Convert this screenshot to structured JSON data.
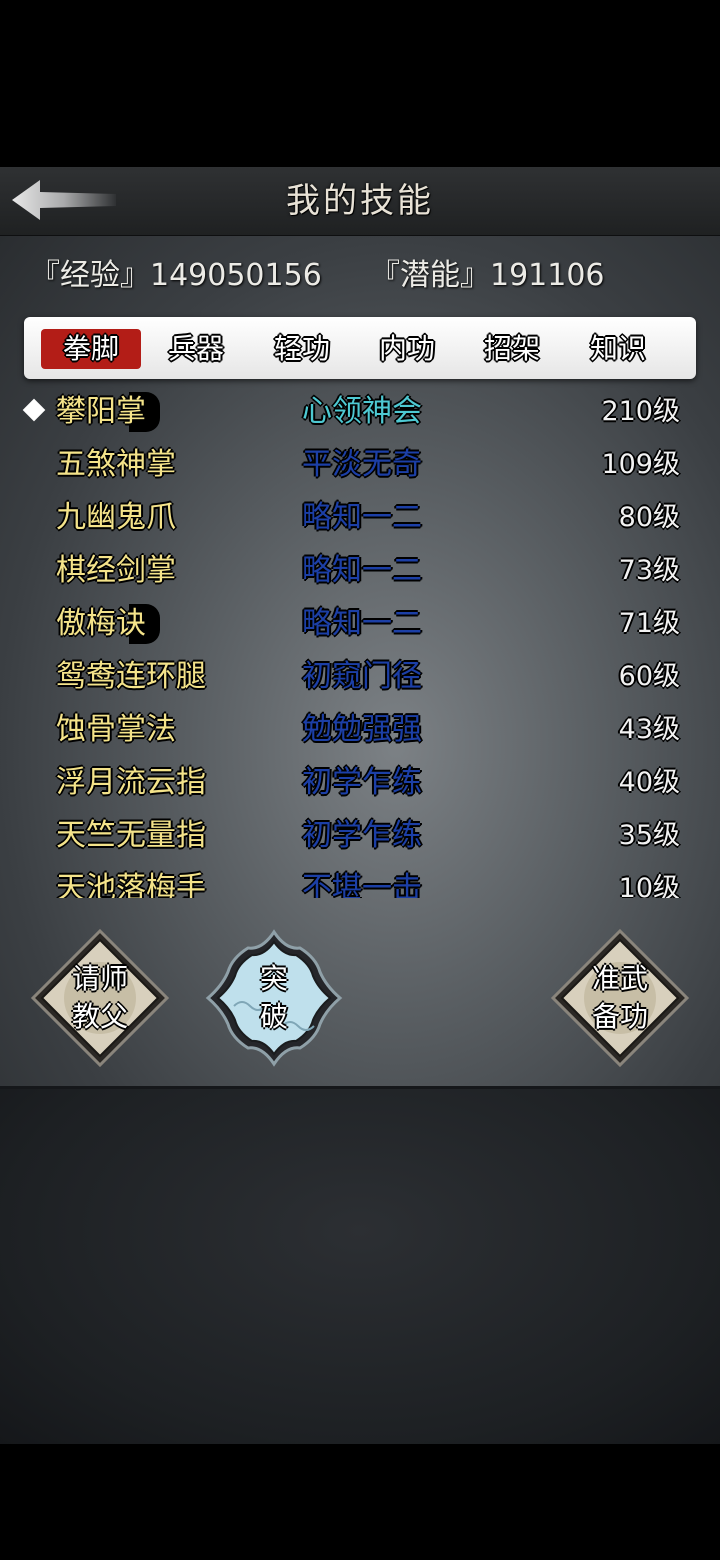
{
  "header": {
    "title": "我的技能",
    "back_icon": "back-arrow-icon"
  },
  "stats": {
    "experience": "『经验』149050156",
    "potential": "『潜能』191106"
  },
  "tabs": [
    {
      "label": "拳脚",
      "active": true
    },
    {
      "label": "兵器",
      "active": false
    },
    {
      "label": "轻功",
      "active": false
    },
    {
      "label": "内功",
      "active": false
    },
    {
      "label": "招架",
      "active": false
    },
    {
      "label": "知识",
      "active": false
    }
  ],
  "skills": [
    {
      "name": "攀阳掌",
      "rank": "心领神会",
      "level": "210级",
      "selected": true
    },
    {
      "name": "五煞神掌",
      "rank": "平淡无奇",
      "level": "109级"
    },
    {
      "name": "九幽鬼爪",
      "rank": "略知一二",
      "level": "80级"
    },
    {
      "name": "棋经剑掌",
      "rank": "略知一二",
      "level": "73级"
    },
    {
      "name": "傲梅诀",
      "rank": "略知一二",
      "level": "71级"
    },
    {
      "name": "鸳鸯连环腿",
      "rank": "初窥门径",
      "level": "60级"
    },
    {
      "name": "蚀骨掌法",
      "rank": "勉勉强强",
      "level": "43级"
    },
    {
      "name": "浮月流云指",
      "rank": "初学乍练",
      "level": "40级"
    },
    {
      "name": "天竺无量指",
      "rank": "初学乍练",
      "level": "35级"
    },
    {
      "name": "天池落梅手",
      "rank": "不堪一击",
      "level": "10级"
    }
  ],
  "actions": {
    "teacher": {
      "line1": "请师",
      "line2": "教父"
    },
    "breakthrough": {
      "line1": "突",
      "line2": "破"
    },
    "prepare": {
      "line1": "准武",
      "line2": "备功"
    }
  },
  "colors": {
    "active_tab": "#b31d17",
    "skill_name": "#f4e38a",
    "rank_blue": "#1c3fa6",
    "rank_teal": "#4ec9d2",
    "breakthrough_fill": "#bfe0ec"
  }
}
